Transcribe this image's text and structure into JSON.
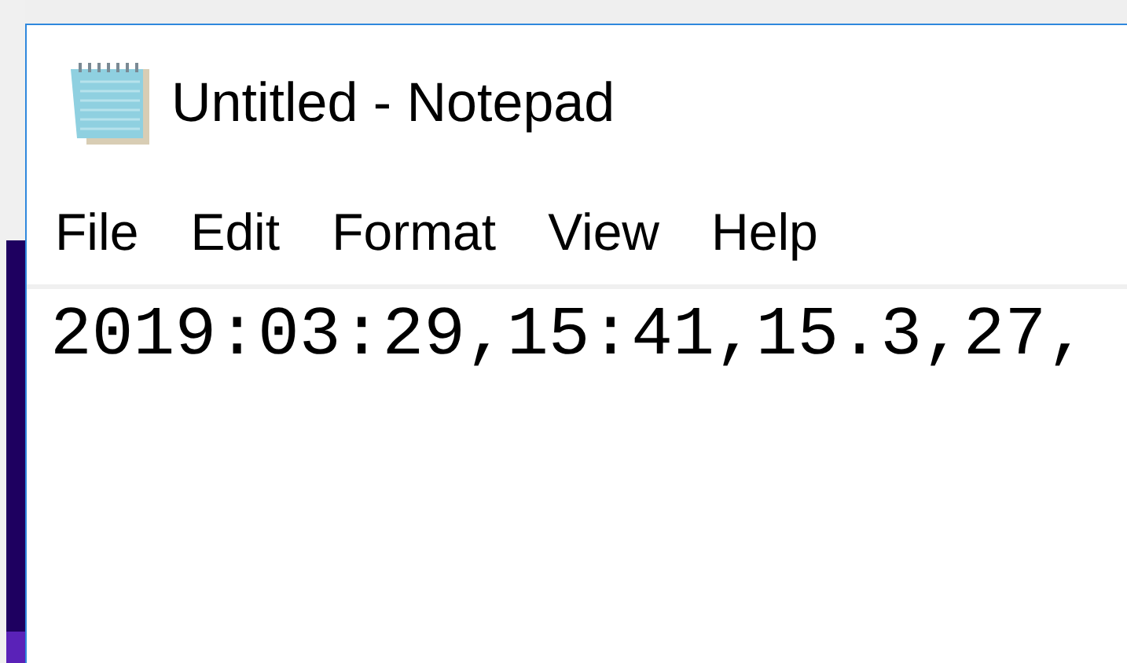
{
  "window": {
    "title": "Untitled - Notepad"
  },
  "menu": [
    "File",
    "Edit",
    "Format",
    "View",
    "Help"
  ],
  "editor": {
    "text": "2019:03:29,15:41,15.3,27,"
  }
}
